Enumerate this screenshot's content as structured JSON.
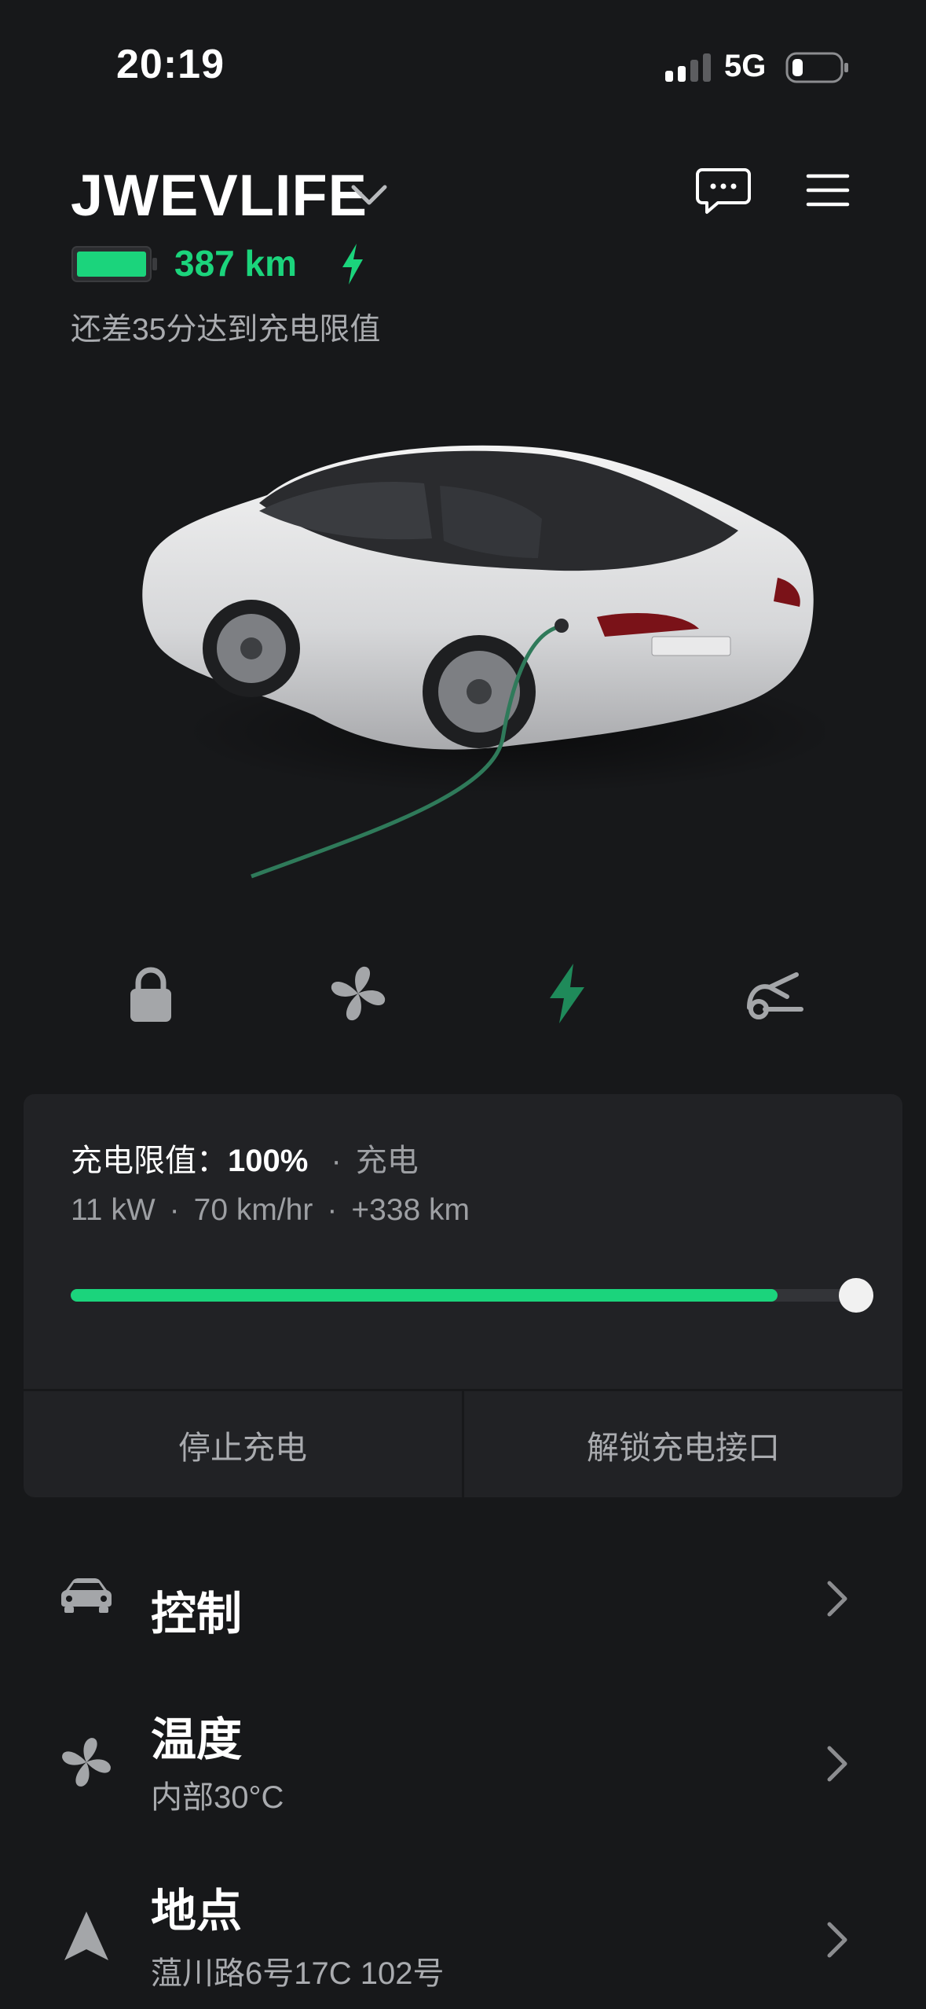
{
  "status_bar": {
    "time": "20:19",
    "network": "5G"
  },
  "header": {
    "vehicle_name": "JWEVLIFE",
    "range": "387 km",
    "charge_eta": "还差35分达到充电限值"
  },
  "quick_actions": [
    "lock-icon",
    "fan-icon",
    "charge-bolt-icon",
    "frunk-icon"
  ],
  "charging": {
    "limit_label": "充电限值：",
    "limit_value": "100%",
    "sep": "·",
    "status": "充电",
    "power": "11 kW",
    "rate": "70 km/hr",
    "added": "+338 km",
    "progress": 0.9,
    "buttons": {
      "stop": "停止充电",
      "unlock_port": "解锁充电接口"
    }
  },
  "menu": [
    {
      "icon": "car-icon",
      "title": "控制",
      "subtitle": ""
    },
    {
      "icon": "fan-icon",
      "title": "温度",
      "subtitle": "内部30°C"
    },
    {
      "icon": "location-arrow-icon",
      "title": "地点",
      "subtitle": "蕰川路6号17C 102号"
    }
  ],
  "colors": {
    "background": "#17181a",
    "card": "#212225",
    "accent_green": "#1bd47c",
    "text_secondary": "#a9abaf"
  }
}
